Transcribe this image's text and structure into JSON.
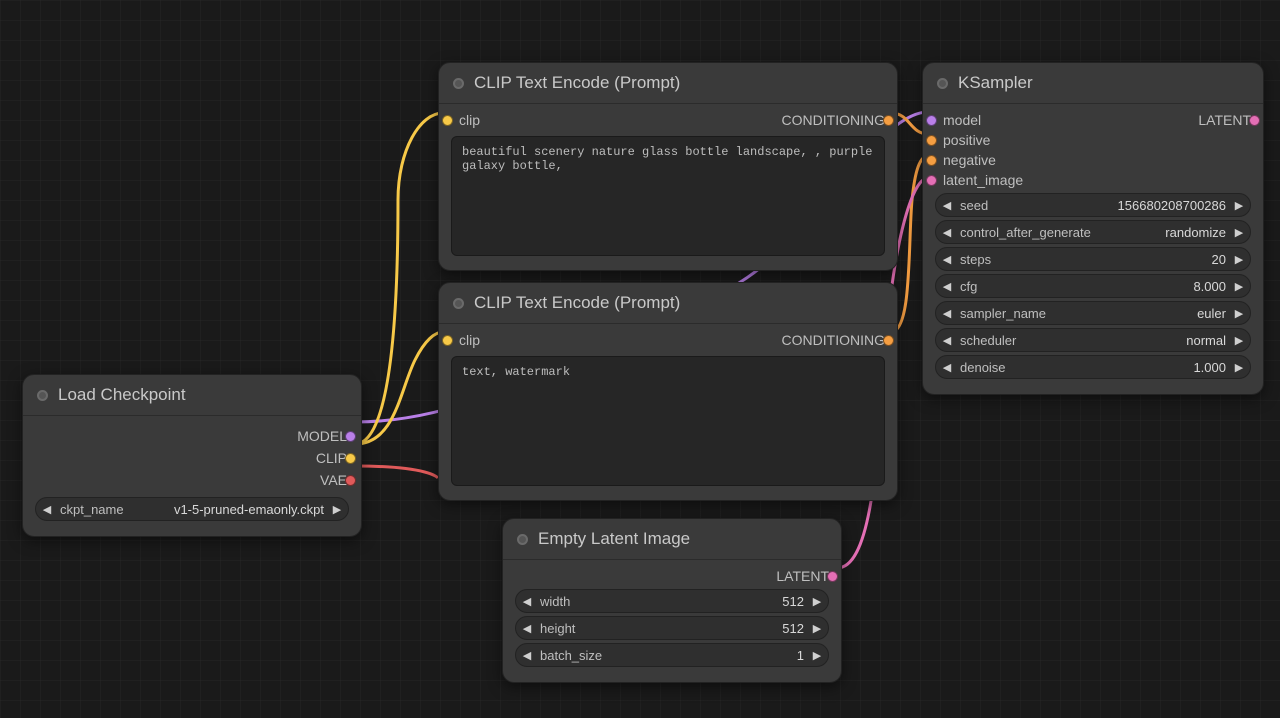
{
  "load_checkpoint": {
    "title": "Load Checkpoint",
    "outputs": {
      "model": "MODEL",
      "clip": "CLIP",
      "vae": "VAE"
    },
    "ckpt_name": {
      "label": "ckpt_name",
      "value": "v1-5-pruned-emaonly.ckpt"
    }
  },
  "clip_pos": {
    "title": "CLIP Text Encode (Prompt)",
    "input_clip": "clip",
    "output_cond": "CONDITIONING",
    "text": "beautiful scenery nature glass bottle landscape, , purple galaxy bottle,"
  },
  "clip_neg": {
    "title": "CLIP Text Encode (Prompt)",
    "input_clip": "clip",
    "output_cond": "CONDITIONING",
    "text": "text, watermark"
  },
  "empty_latent": {
    "title": "Empty Latent Image",
    "output_latent": "LATENT",
    "width": {
      "label": "width",
      "value": "512"
    },
    "height": {
      "label": "height",
      "value": "512"
    },
    "batch": {
      "label": "batch_size",
      "value": "1"
    }
  },
  "ksampler": {
    "title": "KSampler",
    "inputs": {
      "model": "model",
      "positive": "positive",
      "negative": "negative",
      "latent_image": "latent_image"
    },
    "output_latent": "LATENT",
    "seed": {
      "label": "seed",
      "value": "156680208700286"
    },
    "control": {
      "label": "control_after_generate",
      "value": "randomize"
    },
    "steps": {
      "label": "steps",
      "value": "20"
    },
    "cfg": {
      "label": "cfg",
      "value": "8.000"
    },
    "sampler": {
      "label": "sampler_name",
      "value": "euler"
    },
    "sched": {
      "label": "scheduler",
      "value": "normal"
    },
    "denoise": {
      "label": "denoise",
      "value": "1.000"
    }
  }
}
